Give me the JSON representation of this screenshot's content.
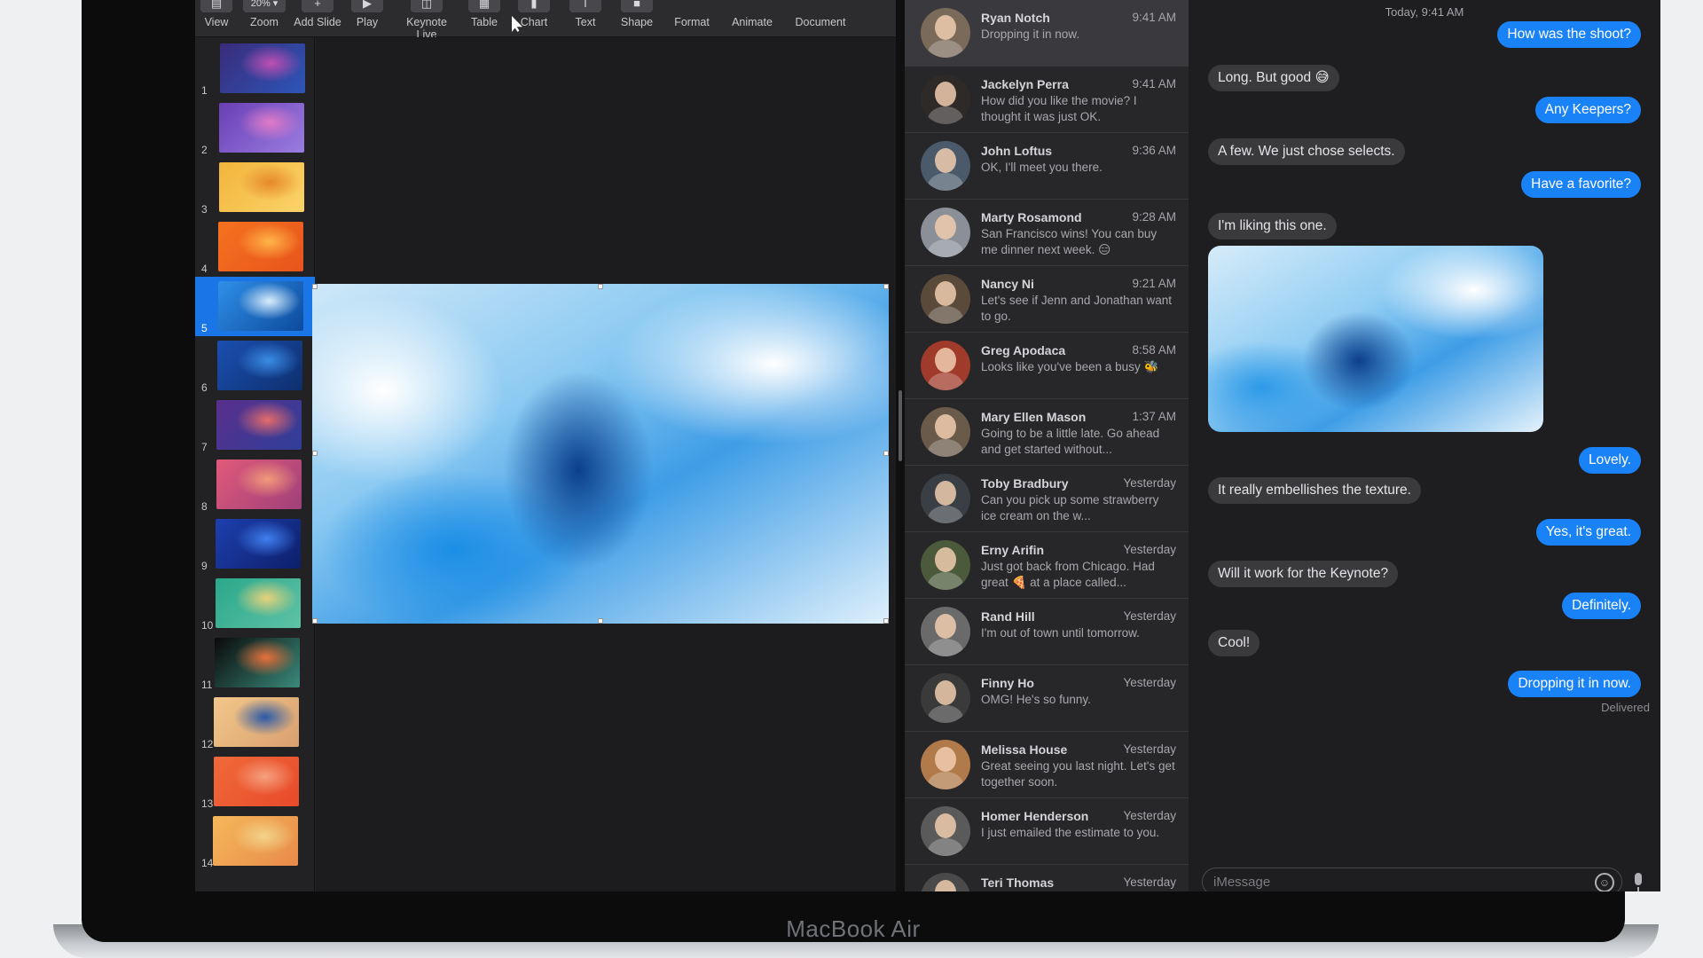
{
  "device": {
    "brand": "MacBook Air"
  },
  "keynote": {
    "toolbar": [
      {
        "id": "view",
        "icon": "sidebar-icon",
        "glyph": "▤",
        "label": "View"
      },
      {
        "id": "zoom",
        "icon": "zoom-menu-icon",
        "glyph": "20% ▾",
        "label": "Zoom"
      },
      {
        "id": "add-slide",
        "icon": "plus-icon",
        "glyph": "+",
        "label": "Add Slide"
      },
      {
        "id": "play",
        "icon": "play-icon",
        "glyph": "▶",
        "label": "Play"
      },
      {
        "id": "keynote-live",
        "icon": "keynote-live-icon",
        "glyph": "◫",
        "label": "Keynote Live"
      },
      {
        "id": "table",
        "icon": "table-icon",
        "glyph": "▦",
        "label": "Table"
      },
      {
        "id": "chart",
        "icon": "chart-icon",
        "glyph": "▮",
        "label": "Chart"
      },
      {
        "id": "text",
        "icon": "text-icon",
        "glyph": "T",
        "label": "Text"
      },
      {
        "id": "shape",
        "icon": "shape-icon",
        "glyph": "■",
        "label": "Shape"
      },
      {
        "id": "format",
        "icon": "format-icon",
        "glyph": "",
        "label": "Format"
      },
      {
        "id": "animate",
        "icon": "animate-icon",
        "glyph": "",
        "label": "Animate"
      },
      {
        "id": "document",
        "icon": "document-icon",
        "glyph": "",
        "label": "Document"
      }
    ],
    "selected_slide": "5",
    "slides": [
      {
        "num": "1",
        "colors": [
          "#3a2b7a",
          "#c04fb3",
          "#2d56b8"
        ]
      },
      {
        "num": "2",
        "colors": [
          "#6a3fb5",
          "#e07ac7",
          "#9a7de0"
        ]
      },
      {
        "num": "3",
        "colors": [
          "#f2b53a",
          "#e7892b",
          "#fbd36a"
        ]
      },
      {
        "num": "4",
        "colors": [
          "#f5721f",
          "#ffb54a",
          "#e8541b"
        ]
      },
      {
        "num": "5",
        "colors": [
          "#2f8fe8",
          "#d9eefb",
          "#0c4a9c"
        ]
      },
      {
        "num": "6",
        "colors": [
          "#1a4fb0",
          "#3a8de6",
          "#0e2f6e"
        ]
      },
      {
        "num": "7",
        "colors": [
          "#5a2f8c",
          "#e56b6b",
          "#2f3f9a"
        ]
      },
      {
        "num": "8",
        "colors": [
          "#e05a7a",
          "#f29a7a",
          "#a0407a"
        ]
      },
      {
        "num": "9",
        "colors": [
          "#1d3fae",
          "#3f7ff0",
          "#0d1f6a"
        ]
      },
      {
        "num": "10",
        "colors": [
          "#2aa88a",
          "#e8d27a",
          "#5fc2a5"
        ]
      },
      {
        "num": "11",
        "colors": [
          "#0a0a0a",
          "#e8703a",
          "#3a8a7a"
        ]
      },
      {
        "num": "12",
        "colors": [
          "#f2c78a",
          "#2a5aa8",
          "#d8a070"
        ]
      },
      {
        "num": "13",
        "colors": [
          "#f06a3a",
          "#f5a080",
          "#e84a2a"
        ]
      },
      {
        "num": "14",
        "colors": [
          "#f5b85a",
          "#f2d48a",
          "#e88a4a"
        ]
      }
    ]
  },
  "messages": {
    "conversations": [
      {
        "name": "Ryan Notch",
        "time": "9:41 AM",
        "preview": "Dropping it in now.",
        "avatar": "#7a6a5a",
        "selected": true
      },
      {
        "name": "Jackelyn Perra",
        "time": "9:41 AM",
        "preview": "How did you like the movie? I thought it was just OK.",
        "avatar": "#2e2a28"
      },
      {
        "name": "John Loftus",
        "time": "9:36 AM",
        "preview": "OK, I'll meet you there.",
        "avatar": "#4a5a6a"
      },
      {
        "name": "Marty Rosamond",
        "time": "9:28 AM",
        "preview": "San Francisco wins! You can buy me dinner next week. 😑",
        "avatar": "#8a8f98"
      },
      {
        "name": "Nancy Ni",
        "time": "9:21 AM",
        "preview": "Let's see if Jenn and Jonathan want to go.",
        "avatar": "#5a4a3a"
      },
      {
        "name": "Greg Apodaca",
        "time": "8:58 AM",
        "preview": "Looks like you've been a busy 🐝",
        "avatar": "#a03a2a"
      },
      {
        "name": "Mary Ellen Mason",
        "time": "1:37 AM",
        "preview": "Going to be a little late. Go ahead and get started without...",
        "avatar": "#6a5a4a"
      },
      {
        "name": "Toby Bradbury",
        "time": "Yesterday",
        "preview": "Can you pick up some strawberry ice cream on the w...",
        "avatar": "#3a3f45"
      },
      {
        "name": "Erny Arifin",
        "time": "Yesterday",
        "preview": "Just got back from Chicago. Had great 🍕 at a place called...",
        "avatar": "#4a5a3a"
      },
      {
        "name": "Rand Hill",
        "time": "Yesterday",
        "preview": "I'm out of town until tomorrow.",
        "avatar": "#6a6a6a"
      },
      {
        "name": "Finny Ho",
        "time": "Yesterday",
        "preview": "OMG! He's so funny.",
        "avatar": "#3a3a3a"
      },
      {
        "name": "Melissa House",
        "time": "Yesterday",
        "preview": "Great seeing you last night. Let's get together soon.",
        "avatar": "#b07a4a"
      },
      {
        "name": "Homer Henderson",
        "time": "Yesterday",
        "preview": "I just emailed the estimate to you.",
        "avatar": "#5a5a5a"
      },
      {
        "name": "Teri Thomas",
        "time": "Yesterday",
        "preview": "",
        "avatar": "#4a4a4a"
      }
    ],
    "chat": {
      "timestamp": "Today, 9:41 AM",
      "messages": [
        {
          "dir": "out",
          "text": "How was the shoot?"
        },
        {
          "dir": "in",
          "text": "Long. But good 😅"
        },
        {
          "dir": "out",
          "text": "Any Keepers?"
        },
        {
          "dir": "in",
          "text": "A few. We just chose selects."
        },
        {
          "dir": "out",
          "text": "Have a favorite?"
        },
        {
          "dir": "in",
          "text": "I'm liking this one."
        },
        {
          "dir": "out",
          "text": "Lovely."
        },
        {
          "dir": "in",
          "text": "It really embellishes the texture."
        },
        {
          "dir": "out",
          "text": "Yes, it's great."
        },
        {
          "dir": "in",
          "text": "Will it work for the Keynote?"
        },
        {
          "dir": "out",
          "text": "Definitely."
        },
        {
          "dir": "in",
          "text": "Cool!"
        },
        {
          "dir": "out",
          "text": "Dropping it in now."
        }
      ],
      "status": "Delivered",
      "compose_placeholder": "iMessage",
      "emoji_glyph": "☺"
    }
  }
}
